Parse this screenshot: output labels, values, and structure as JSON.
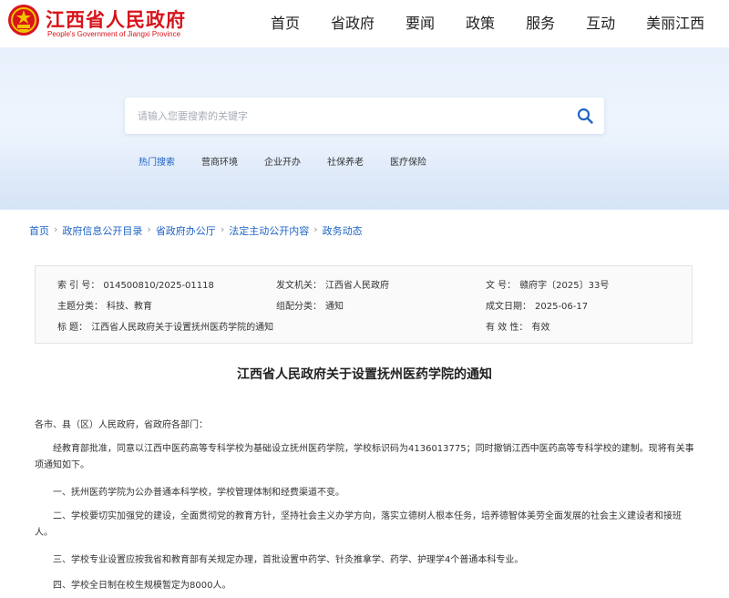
{
  "header": {
    "site_name": "江西省人民政府",
    "site_name_en": "People's Government of Jiangxi Province",
    "nav": [
      "首页",
      "省政府",
      "要闻",
      "政策",
      "服务",
      "互动",
      "美丽江西"
    ]
  },
  "search": {
    "placeholder": "请输入您要搜索的关键字",
    "hot_label": "热门搜索",
    "hot_items": [
      "营商环境",
      "企业开办",
      "社保养老",
      "医疗保险"
    ]
  },
  "breadcrumb": [
    "首页",
    "政府信息公开目录",
    "省政府办公厅",
    "法定主动公开内容",
    "政务动态"
  ],
  "info": {
    "index_no_label": "索  引  号：",
    "index_no": "014500810/2025-01118",
    "issuer_label": "发文机关：",
    "issuer": "江西省人民政府",
    "doc_no_label": "文      号：",
    "doc_no": "赣府字〔2025〕33号",
    "topic_label": "主题分类：",
    "topic": "科技、教育",
    "org_label": "组配分类：",
    "org": "通知",
    "date_label": "成文日期：",
    "date": "2025-06-17",
    "subject_label": "标      题：",
    "subject": "江西省人民政府关于设置抚州医药学院的通知",
    "validity_label": "有  效  性：",
    "validity": "有效"
  },
  "article": {
    "title": "江西省人民政府关于设置抚州医药学院的通知",
    "salutation": "各市、县（区）人民政府，省政府各部门：",
    "paragraphs": [
      "经教育部批准，同意以江西中医药高等专科学校为基础设立抚州医药学院，学校标识码为4136013775；同时撤销江西中医药高等专科学校的建制。现将有关事项通知如下。",
      "一、抚州医药学院为公办普通本科学校，学校管理体制和经费渠道不变。",
      "二、学校要切实加强党的建设，全面贯彻党的教育方针，坚持社会主义办学方向，落实立德树人根本任务，培养德智体美劳全面发展的社会主义建设者和接班人。",
      "三、学校专业设置应按我省和教育部有关规定办理，首批设置中药学、针灸推拿学、药学、护理学4个普通本科专业。",
      "四、学校全日制在校生规模暂定为8000人。"
    ]
  },
  "colors": {
    "brand_red": "#d8141b",
    "link_blue": "#1e63c4"
  }
}
